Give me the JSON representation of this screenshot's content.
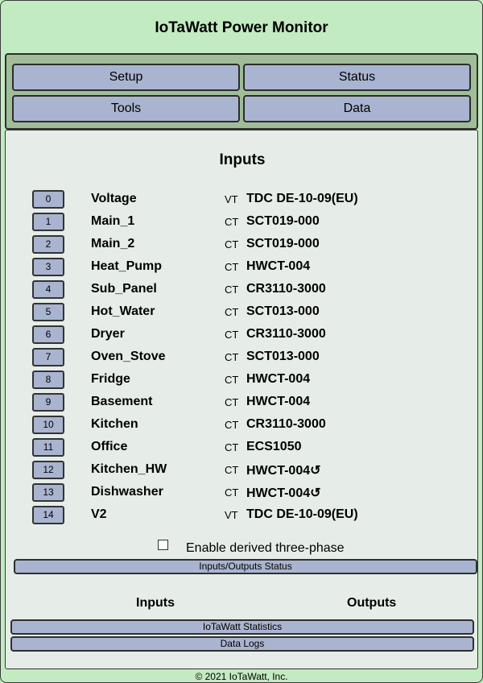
{
  "app": {
    "title": "IoTaWatt Power Monitor"
  },
  "nav": {
    "setup": "Setup",
    "status": "Status",
    "tools": "Tools",
    "data": "Data"
  },
  "inputs_section": {
    "title": "Inputs",
    "rows": [
      {
        "channel": "0",
        "name": "Voltage",
        "type": "VT",
        "model": "TDC DE-10-09(EU)"
      },
      {
        "channel": "1",
        "name": "Main_1",
        "type": "CT",
        "model": "SCT019-000"
      },
      {
        "channel": "2",
        "name": "Main_2",
        "type": "CT",
        "model": "SCT019-000"
      },
      {
        "channel": "3",
        "name": "Heat_Pump",
        "type": "CT",
        "model": "HWCT-004"
      },
      {
        "channel": "4",
        "name": "Sub_Panel",
        "type": "CT",
        "model": "CR3110-3000"
      },
      {
        "channel": "5",
        "name": "Hot_Water",
        "type": "CT",
        "model": "SCT013-000"
      },
      {
        "channel": "6",
        "name": "Dryer",
        "type": "CT",
        "model": "CR3110-3000"
      },
      {
        "channel": "7",
        "name": "Oven_Stove",
        "type": "CT",
        "model": "SCT013-000"
      },
      {
        "channel": "8",
        "name": "Fridge",
        "type": "CT",
        "model": "HWCT-004"
      },
      {
        "channel": "9",
        "name": "Basement",
        "type": "CT",
        "model": "HWCT-004"
      },
      {
        "channel": "10",
        "name": "Kitchen",
        "type": "CT",
        "model": "CR3110-3000"
      },
      {
        "channel": "11",
        "name": "Office",
        "type": "CT",
        "model": "ECS1050"
      },
      {
        "channel": "12",
        "name": "Kitchen_HW",
        "type": "CT",
        "model": "HWCT-004↺"
      },
      {
        "channel": "13",
        "name": "Dishwasher",
        "type": "CT",
        "model": "HWCT-004↺"
      },
      {
        "channel": "14",
        "name": "V2",
        "type": "VT",
        "model": "TDC DE-10-09(EU)"
      }
    ],
    "derived_three_phase_label": "Enable derived three-phase"
  },
  "status_buttons": {
    "io_status": "Inputs/Outputs Status",
    "statistics": "IoTaWatt Statistics",
    "data_logs": "Data Logs"
  },
  "io_headings": {
    "inputs": "Inputs",
    "outputs": "Outputs"
  },
  "footer": {
    "copyright": "© 2021 IoTaWatt, Inc."
  }
}
